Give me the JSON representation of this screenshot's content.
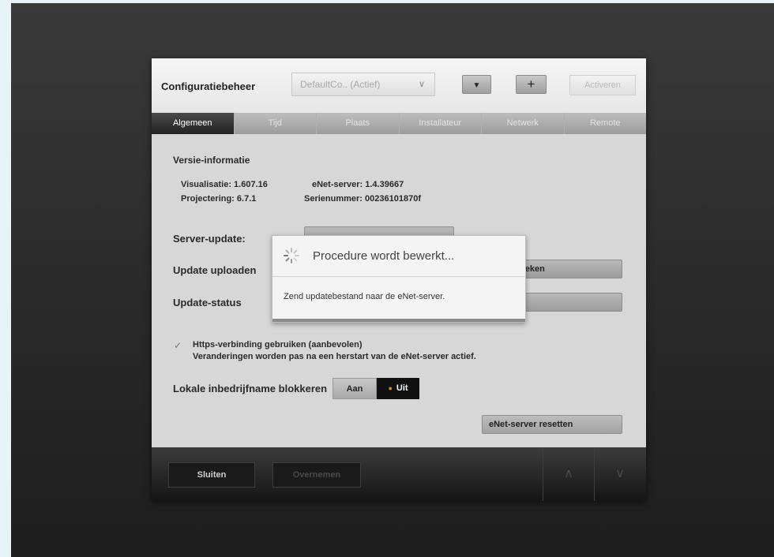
{
  "header": {
    "title": "Configuratiebeheer",
    "config_select": "DefaultCo.. (Actief)",
    "add_label": "+",
    "activate_label": "Activeren"
  },
  "tabs": [
    {
      "label": "Algemeen",
      "active": true
    },
    {
      "label": "Tijd"
    },
    {
      "label": "Plaats"
    },
    {
      "label": "Installateur"
    },
    {
      "label": "Netwerk"
    },
    {
      "label": "Remote"
    }
  ],
  "version": {
    "heading": "Versie-informatie",
    "visualisatie": "Visualisatie: 1.607.16",
    "projectering": "Projectering: 6.7.1",
    "server": "eNet-server: 1.4.39667",
    "serial": "Serienummer: 00236101870f"
  },
  "server_update": {
    "label": "Server-update:"
  },
  "upload": {
    "label": "Update uploaden",
    "button_visible": "oeken"
  },
  "update_status": {
    "label": "Update-status"
  },
  "https": {
    "checked": true,
    "line1": "Https-verbinding gebruiken (aanbevolen)",
    "line2": "Veranderingen worden pas na een herstart van de eNet-server actief."
  },
  "local_block": {
    "label": "Lokale inbedrijfname blokkeren",
    "on_label": "Aan",
    "off_label": "Uit",
    "selected": "Uit"
  },
  "reset_button": "eNet-server resetten",
  "footer": {
    "close_label": "Sluiten",
    "apply_label": "Overnemen"
  },
  "dialog": {
    "title": "Procedure wordt bewerkt...",
    "message": "Zend updatebestand naar de eNet-server."
  },
  "colors": {
    "accent_dot": "#e08a00",
    "active_tab": "#2a2a2a"
  }
}
